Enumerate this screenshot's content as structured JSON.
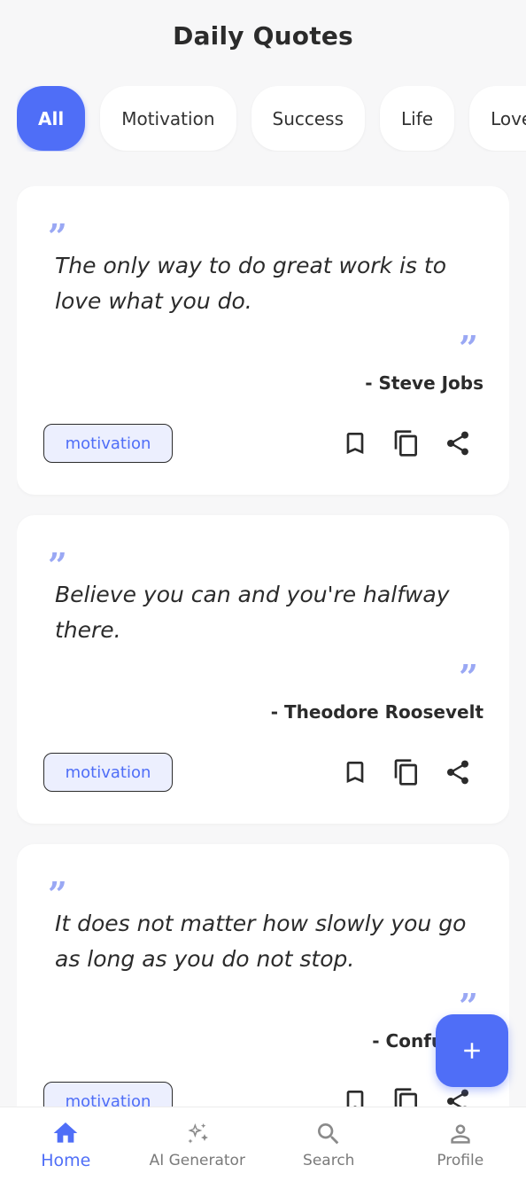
{
  "app": {
    "title": "Daily Quotes"
  },
  "categories": [
    {
      "label": "All",
      "active": true
    },
    {
      "label": "Motivation",
      "active": false
    },
    {
      "label": "Success",
      "active": false
    },
    {
      "label": "Life",
      "active": false
    },
    {
      "label": "Love",
      "active": false
    }
  ],
  "quotes": [
    {
      "text": "The only way to do great work is to love what you do.",
      "author": "- Steve Jobs",
      "tag": "motivation"
    },
    {
      "text": "Believe you can and you're halfway there.",
      "author": "- Theodore Roosevelt",
      "tag": "motivation"
    },
    {
      "text": "It does not matter how slowly you go as long as you do not stop.",
      "author": "- Confucius",
      "tag": "motivation"
    }
  ],
  "fab": {
    "icon": "plus-icon"
  },
  "nav": [
    {
      "label": "Home",
      "icon": "home-icon",
      "active": true
    },
    {
      "label": "AI Generator",
      "icon": "sparkles-icon",
      "active": false
    },
    {
      "label": "Search",
      "icon": "search-icon",
      "active": false
    },
    {
      "label": "Profile",
      "icon": "person-icon",
      "active": false
    }
  ],
  "colors": {
    "accent": "#4f6ef7",
    "quote_mark": "#9aa8f4",
    "tag_bg": "#eceffe",
    "background": "#f7f7f8"
  }
}
